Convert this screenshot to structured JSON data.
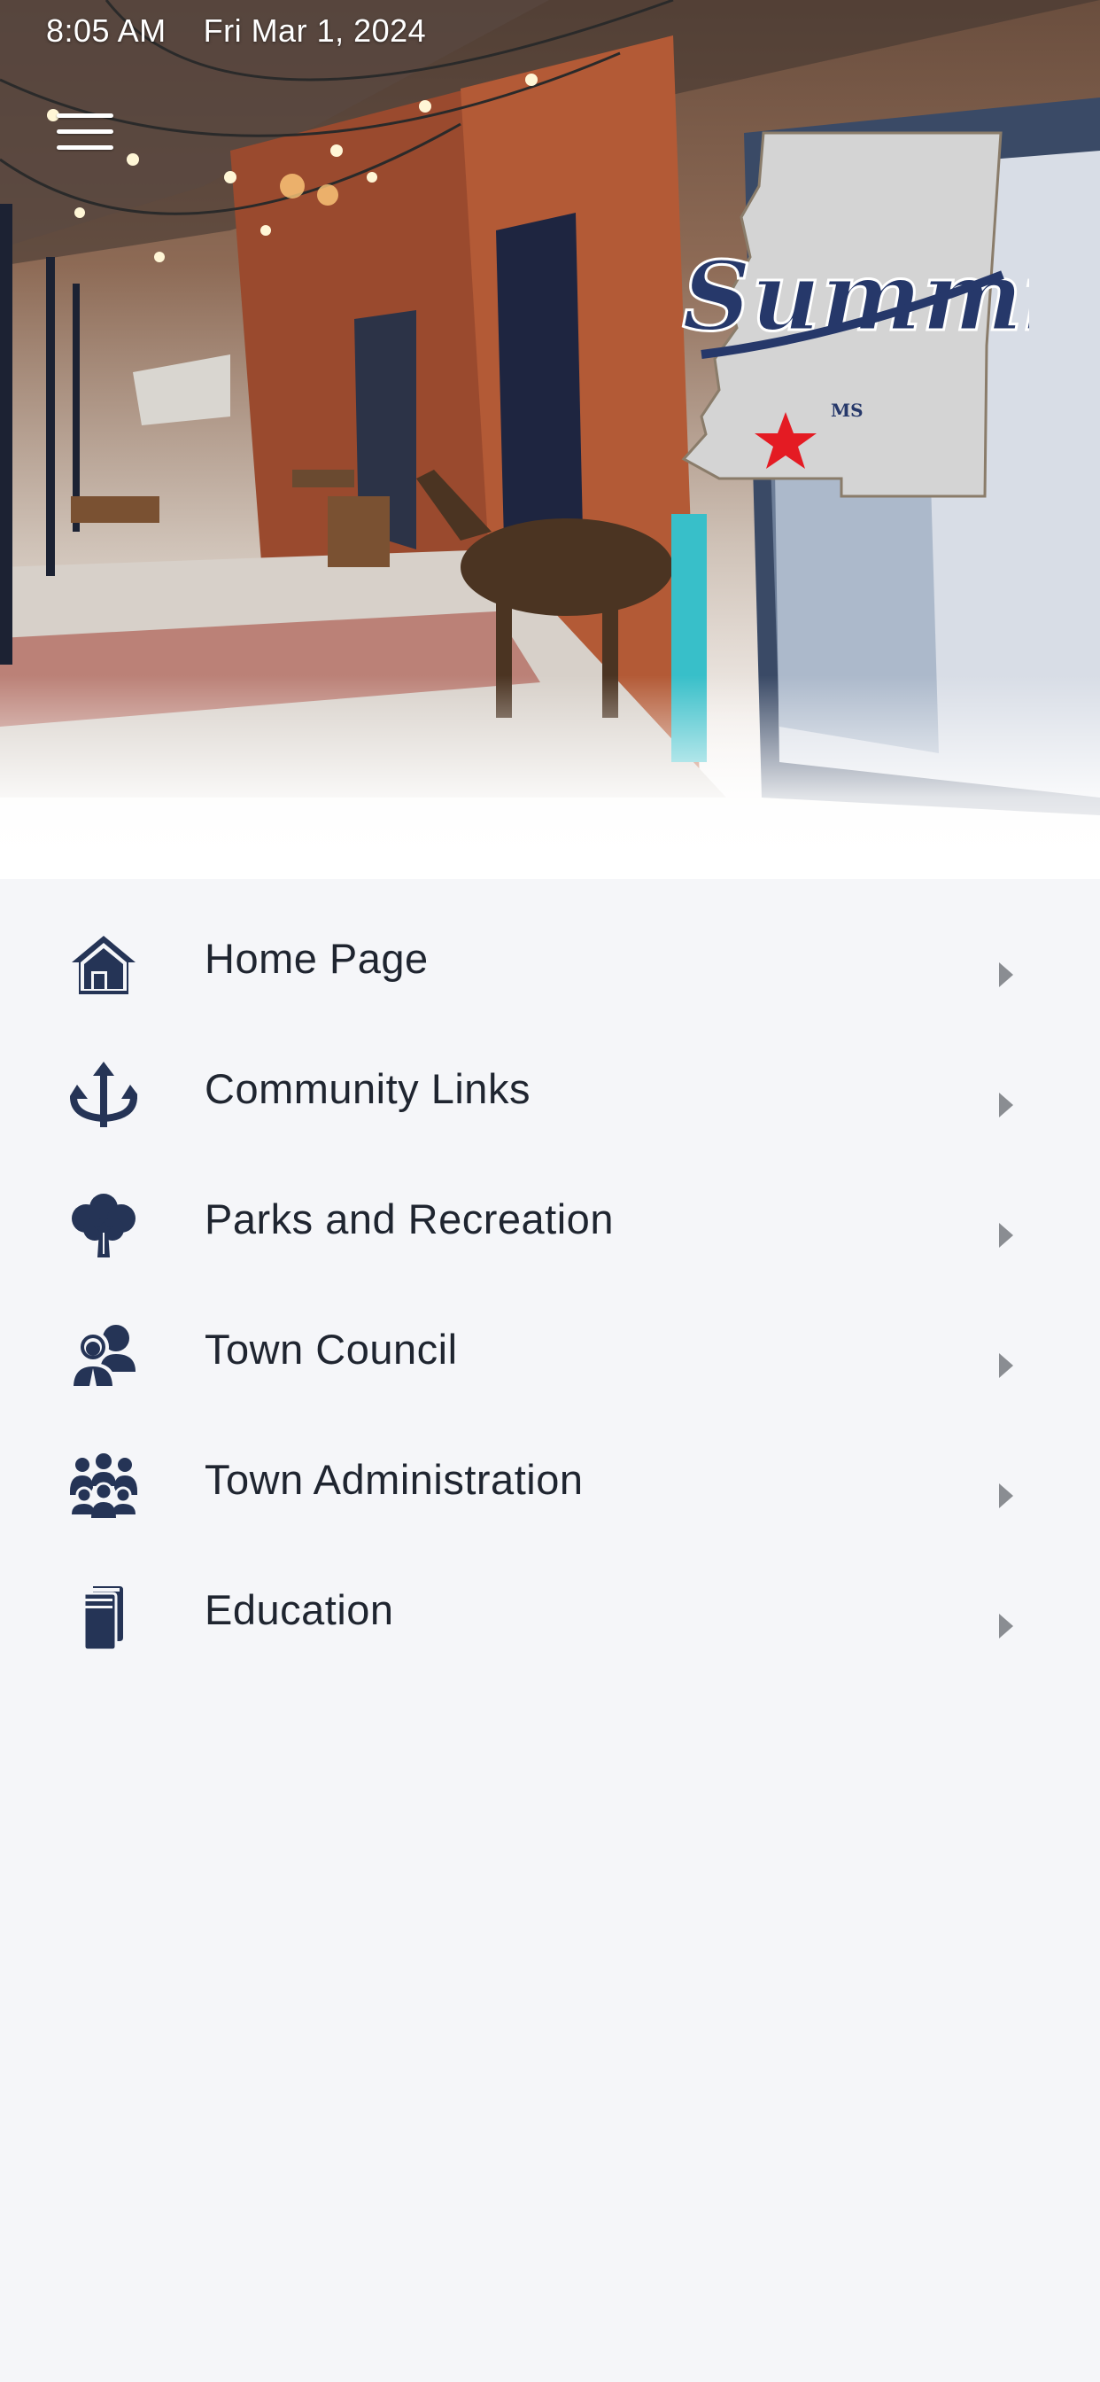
{
  "status_bar": {
    "time": "8:05 AM",
    "date": "Fri Mar 1, 2024"
  },
  "header": {
    "menu_icon": "hamburger-icon",
    "logo": {
      "script_text": "Summit",
      "state_abbr": "MS",
      "colors": {
        "map_fill": "#d4d4d4",
        "script": "#26386a",
        "star": "#e41b23"
      }
    }
  },
  "menu": {
    "items": [
      {
        "label": "Home Page",
        "icon": "house-icon"
      },
      {
        "label": "Community Links",
        "icon": "trident-arrows-icon"
      },
      {
        "label": "Parks and Recreation",
        "icon": "tree-icon"
      },
      {
        "label": "Town Council",
        "icon": "council-people-icon"
      },
      {
        "label": "Town Administration",
        "icon": "group-people-icon"
      },
      {
        "label": "Education",
        "icon": "books-icon"
      }
    ]
  },
  "colors": {
    "icon": "#253456",
    "label_text": "#1f2530",
    "chevron": "#8a8d92",
    "background": "#f5f6f9"
  }
}
